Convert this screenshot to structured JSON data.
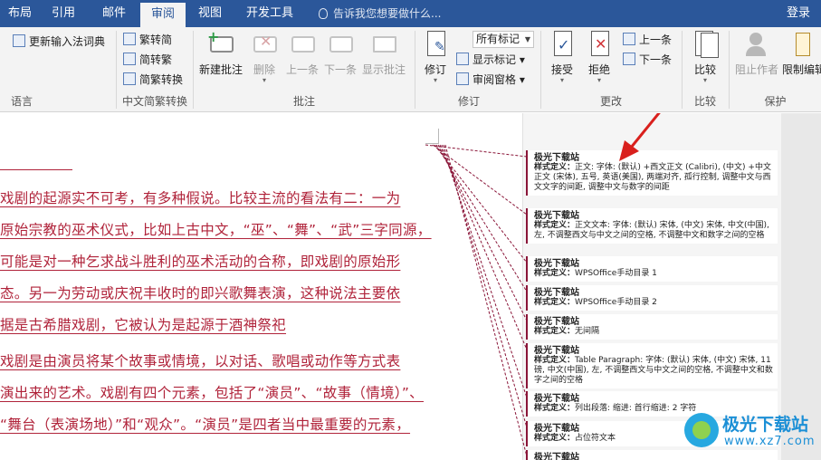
{
  "tabs": [
    {
      "label": "布局"
    },
    {
      "label": "引用"
    },
    {
      "label": "邮件"
    },
    {
      "label": "审阅",
      "active": true
    },
    {
      "label": "视图"
    },
    {
      "label": "开发工具"
    }
  ],
  "tell_me": "告诉我您想要做什么...",
  "login": "登录",
  "ribbon": {
    "language": {
      "update_dict": "更新输入法词典",
      "group_label": "语言"
    },
    "chinese_conversion": {
      "to_simplified": "繁转简",
      "to_traditional": "简转繁",
      "convert": "简繁转换",
      "group_label": "中文简繁转换"
    },
    "comments": {
      "new": "新建批注",
      "delete": "删除",
      "previous": "上一条",
      "next": "下一条",
      "show": "显示批注",
      "group_label": "批注"
    },
    "tracking": {
      "track": "修订",
      "markup_select": "所有标记",
      "show_markup": "显示标记",
      "reviewing_pane": "审阅窗格",
      "group_label": "修订"
    },
    "changes": {
      "accept": "接受",
      "reject": "拒绝",
      "previous": "上一条",
      "next": "下一条",
      "group_label": "更改"
    },
    "compare": {
      "compare": "比较",
      "group_label": "比较"
    },
    "protect": {
      "block_authors": "阻止作者",
      "restrict_editing": "限制编辑",
      "group_label": "保护"
    }
  },
  "document": {
    "lines": [
      "戏剧的起源实不可考，有多种假说。比较主流的看法有二：一为",
      "原始宗教的巫术仪式，比如上古中文，“巫”、“舞”、“武”三字同源，",
      "可能是对一种乞求战斗胜利的巫术活动的合称，即戏剧的原始形",
      "态。另一为劳动或庆祝丰收时的即兴歌舞表演，这种说法主要依",
      "据是古希腊戏剧，它被认为是起源于酒神祭祀",
      "戏剧是由演员将某个故事或情境，以对话、歌唱或动作等方式表",
      "演出来的艺术。戏剧有四个元素，包括了“演员”、“故事（情境）”、",
      "“舞台（表演场地）”和“观众”。“演员”是四者当中最重要的元素，"
    ]
  },
  "markup": {
    "balloons": [
      {
        "author": "极光下载站",
        "label": "样式定义：",
        "text": "正文: 字体: (默认) +西文正文 (Calibri), (中文) +中文正文 (宋体), 五号, 英语(美国), 两端对齐, 孤行控制, 调整中文与西文文字的间距, 调整中文与数字的间距"
      },
      {
        "author": "极光下载站",
        "label": "样式定义：",
        "text": "正文文本: 字体: (默认) 宋体, (中文) 宋体, 中文(中国), 左, 不调整西文与中文之间的空格, 不调整中文和数字之间的空格"
      },
      {
        "author": "极光下载站",
        "label": "样式定义：",
        "text": "WPSOffice手动目录 1"
      },
      {
        "author": "极光下载站",
        "label": "样式定义：",
        "text": "WPSOffice手动目录 2"
      },
      {
        "author": "极光下载站",
        "label": "样式定义：",
        "text": "无间隔"
      },
      {
        "author": "极光下载站",
        "label": "样式定义：",
        "text": "Table Paragraph: 字体: (默认) 宋体, (中文) 宋体, 11 磅, 中文(中国), 左, 不调整西文与中文之间的空格, 不调整中文和数字之间的空格"
      },
      {
        "author": "极光下载站",
        "label": "样式定义：",
        "text": "列出段落: 缩进: 首行缩进: 2 字符"
      },
      {
        "author": "极光下载站",
        "label": "样式定义：",
        "text": "占位符文本"
      },
      {
        "author": "极光下载站",
        "label": "",
        "text": ""
      }
    ]
  },
  "watermark": {
    "title": "极光下载站",
    "url": "www.xz7.com"
  },
  "colors": {
    "tab_bar": "#2b579a",
    "revision": "#b0233a",
    "balloon_border": "#8a1538",
    "annotation_arrow": "#d9201d"
  }
}
